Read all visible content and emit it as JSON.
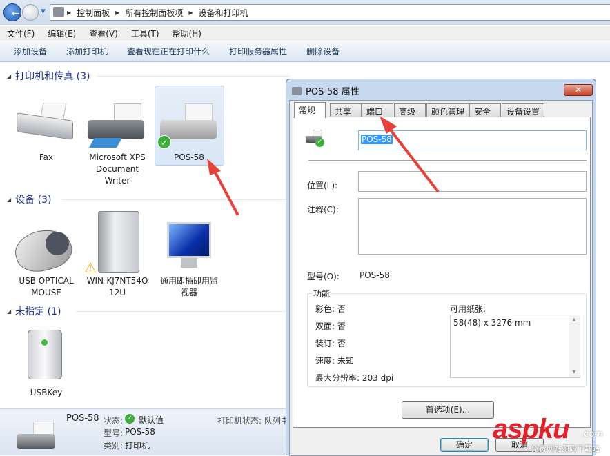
{
  "address": {
    "crumbs": [
      "控制面板",
      "所有控制面板项",
      "设备和打印机"
    ]
  },
  "menu": [
    "文件(F)",
    "编辑(E)",
    "查看(V)",
    "工具(T)",
    "帮助(H)"
  ],
  "toolbar": [
    "添加设备",
    "添加打印机",
    "查看现在正在打印什么",
    "打印服务器属性",
    "删除设备"
  ],
  "sections": {
    "printers": {
      "title": "打印机和传真 (3)",
      "items": [
        {
          "l1": "Fax"
        },
        {
          "l1": "Microsoft XPS",
          "l2": "Document",
          "l3": "Writer"
        },
        {
          "l1": "POS-58",
          "selected": true
        }
      ]
    },
    "devices": {
      "title": "设备 (3)",
      "items": [
        {
          "l1": "USB OPTICAL",
          "l2": "MOUSE"
        },
        {
          "l1": "WIN-KJ7NT54O",
          "l2": "12U"
        },
        {
          "l1": "通用即插即用监",
          "l2": "视器"
        }
      ]
    },
    "unspecified": {
      "title": "未指定 (1)",
      "items": [
        {
          "l1": "USBKey"
        }
      ]
    }
  },
  "details": {
    "name": "POS-58",
    "status_label": "状态:",
    "status": "默认值",
    "model_label": "型号:",
    "model": "POS-58",
    "category_label": "类别:",
    "category": "打印机",
    "printer_status": "打印机状态: 队列中"
  },
  "dialog": {
    "title": "POS-58 属性",
    "close": "✕",
    "tabs": [
      "常规",
      "共享",
      "端口",
      "高级",
      "颜色管理",
      "安全",
      "设备设置"
    ],
    "active_tab": "常规",
    "name_value": "POS-58",
    "location_label": "位置(L):",
    "location_value": "",
    "comment_label": "注释(C):",
    "comment_value": "",
    "model_label": "型号(O):",
    "model_value": "POS-58",
    "features": {
      "title": "功能",
      "color": "彩色: 否",
      "duplex": "双面: 否",
      "staple": "装订: 否",
      "speed": "速度: 未知",
      "resolution": "最大分辨率: 203 dpi",
      "paper_label": "可用纸张:",
      "paper": [
        "58(48) x 3276 mm"
      ]
    },
    "prefs_button": "首选项(E)...",
    "ok": "确定",
    "cancel": "取消"
  },
  "watermark": {
    "brand": "aspku",
    "tld": ".com",
    "tagline": "免费网站源码下载站"
  },
  "colors": {
    "annotation_arrow": "#e8413a",
    "accent": "#1e3287",
    "selection": "#3399ff"
  }
}
